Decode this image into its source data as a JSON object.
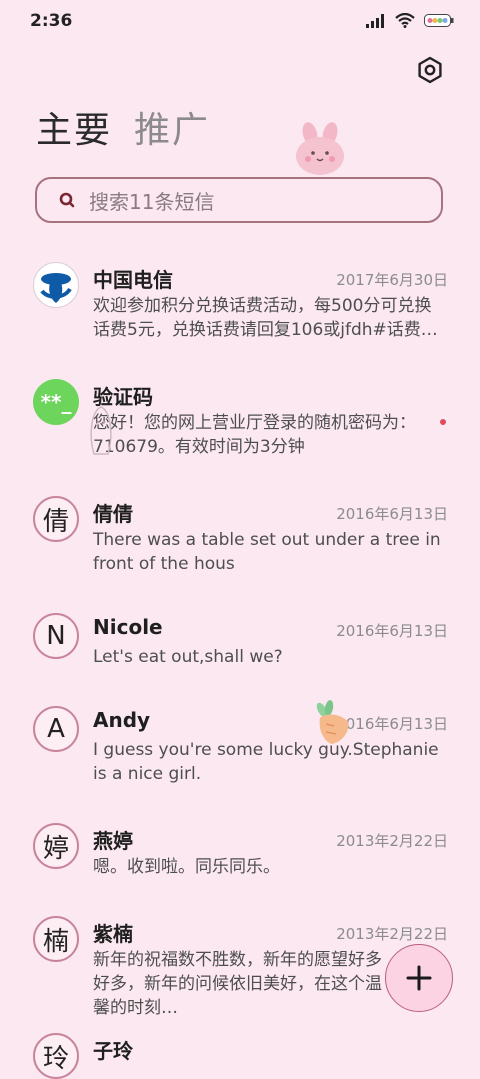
{
  "status_bar": {
    "time": "2:36",
    "signal_icon": "signal-icon",
    "wifi_icon": "wifi-icon",
    "battery_icon": "battery-icon"
  },
  "header": {
    "settings_icon": "settings-icon",
    "tabs": [
      {
        "label": "主要",
        "active": true
      },
      {
        "label": "推广",
        "active": false
      }
    ]
  },
  "search": {
    "placeholder": "搜索11条短信",
    "icon": "search-icon"
  },
  "messages": [
    {
      "name": "中国电信",
      "date": "2017年6月30日",
      "preview": "欢迎参加积分兑换话费活动，每500分可兑换话费5元，兑换话费请回复106或jfdh#话费…",
      "avatar": "China Telecom logo"
    },
    {
      "name": "验证码",
      "date": "",
      "preview": "您好！您的网上营业厅登录的随机密码为：710679。有效时间为3分钟",
      "avatar": "**_"
    },
    {
      "name": "倩倩",
      "date": "2016年6月13日",
      "preview": "There was a table set out under a tree in front of the hous",
      "avatar": "倩"
    },
    {
      "name": "Nicole",
      "date": "2016年6月13日",
      "preview": "Let's eat out,shall we?",
      "avatar": "N"
    },
    {
      "name": "Andy",
      "date": "2016年6月13日",
      "preview": "I guess you're some lucky guy.Stephanie is a nice girl.",
      "avatar": "A"
    },
    {
      "name": "燕婷",
      "date": "2013年2月22日",
      "preview": "嗯。收到啦。同乐同乐。",
      "avatar": "婷"
    },
    {
      "name": "紫楠",
      "date": "2013年2月22日",
      "preview": "新年的祝福数不胜数，新年的愿望好多好多，新年的问候依旧美好，在这个温馨的时刻…",
      "avatar": "楠"
    },
    {
      "name": "子玲",
      "date": "",
      "preview": "",
      "avatar": "玲"
    }
  ],
  "fab": {
    "icon": "plus-icon"
  },
  "colors": {
    "background": "#fbe8f1",
    "accent": "#b85f82",
    "avatar_border": "#c9849d"
  }
}
